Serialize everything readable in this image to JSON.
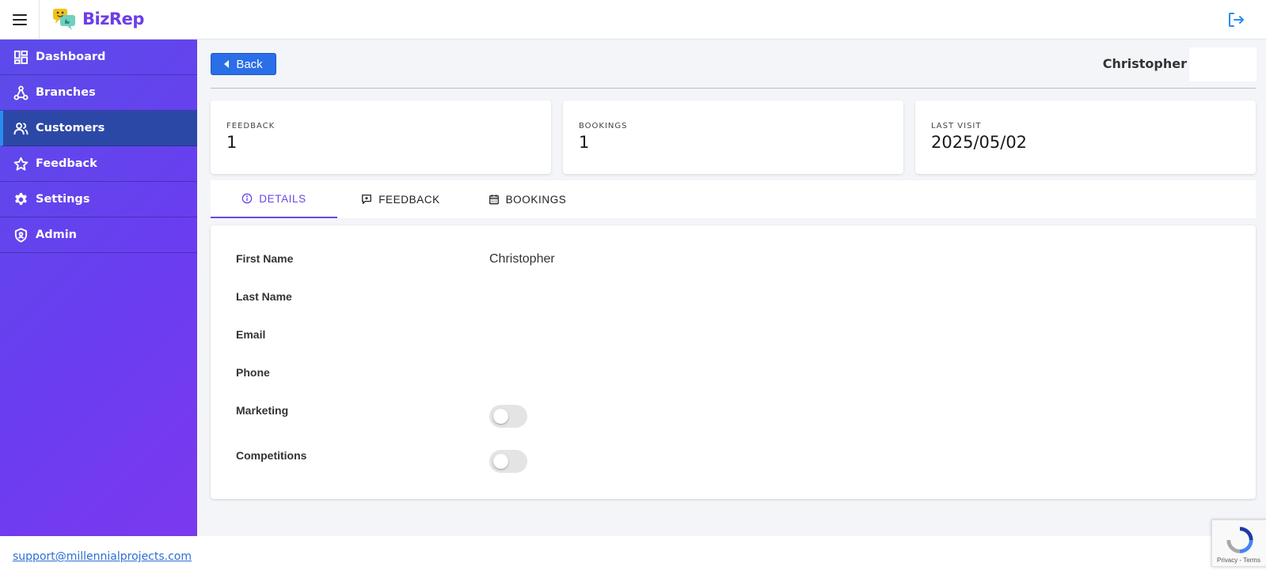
{
  "app": {
    "name": "BizRep"
  },
  "sidebar": {
    "items": [
      {
        "label": "Dashboard",
        "icon": "dashboard-icon"
      },
      {
        "label": "Branches",
        "icon": "branches-icon"
      },
      {
        "label": "Customers",
        "icon": "users-icon",
        "active": true
      },
      {
        "label": "Feedback",
        "icon": "star-icon"
      },
      {
        "label": "Settings",
        "icon": "gear-icon"
      },
      {
        "label": "Admin",
        "icon": "shield-icon"
      }
    ]
  },
  "header": {
    "back_label": "Back",
    "customer_name": "Christopher"
  },
  "stats": [
    {
      "label": "FEEDBACK",
      "value": "1"
    },
    {
      "label": "BOOKINGS",
      "value": "1"
    },
    {
      "label": "LAST VISIT",
      "value": "2025/05/02"
    }
  ],
  "tabs": [
    {
      "label": "DETAILS",
      "icon": "info-icon",
      "active": true
    },
    {
      "label": "FEEDBACK",
      "icon": "comment-plus-icon"
    },
    {
      "label": "BOOKINGS",
      "icon": "calendar-icon"
    }
  ],
  "details": {
    "first_name_label": "First Name",
    "first_name_value": "Christopher",
    "last_name_label": "Last Name",
    "last_name_value": "",
    "email_label": "Email",
    "email_value": "",
    "phone_label": "Phone",
    "phone_value": "",
    "marketing_label": "Marketing",
    "marketing_enabled": false,
    "competitions_label": "Competitions",
    "competitions_enabled": false
  },
  "footer": {
    "support_email": "support@millennialprojects.com"
  },
  "recaptcha": {
    "text": "Privacy - Terms"
  },
  "colors": {
    "accent": "#6b47e8",
    "button": "#2a6ee8",
    "sidebar_active": "#2c48a6"
  }
}
